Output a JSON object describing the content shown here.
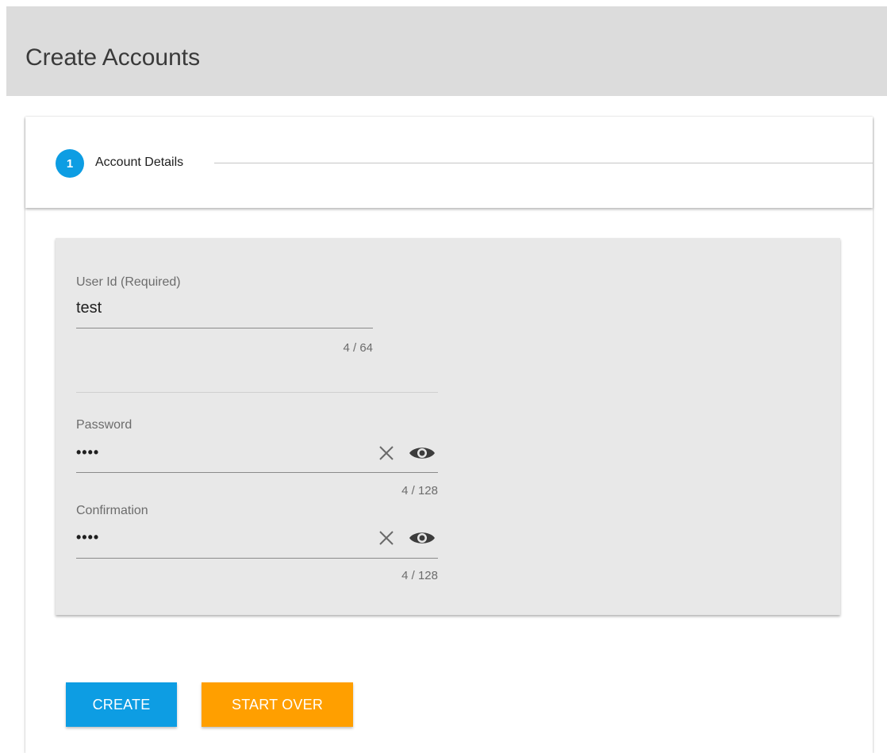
{
  "page": {
    "title": "Create Accounts"
  },
  "stepper": {
    "step_number": "1",
    "step_label": "Account Details"
  },
  "form": {
    "user_id": {
      "label": "User Id (Required)",
      "value": "test",
      "counter": "4 / 64"
    },
    "password": {
      "label": "Password",
      "value": "••••",
      "counter": "4 / 128",
      "icons": [
        "clear-icon",
        "eye-icon"
      ]
    },
    "confirmation": {
      "label": "Confirmation",
      "value": "••••",
      "counter": "4 / 128",
      "icons": [
        "clear-icon",
        "eye-icon"
      ]
    }
  },
  "actions": {
    "create_label": "CREATE",
    "start_over_label": "START OVER"
  },
  "colors": {
    "header_bg": "#dcdcdc",
    "primary": "#0d9de3",
    "accent": "#ff9f00",
    "panel_bg": "#e8e8e8"
  }
}
